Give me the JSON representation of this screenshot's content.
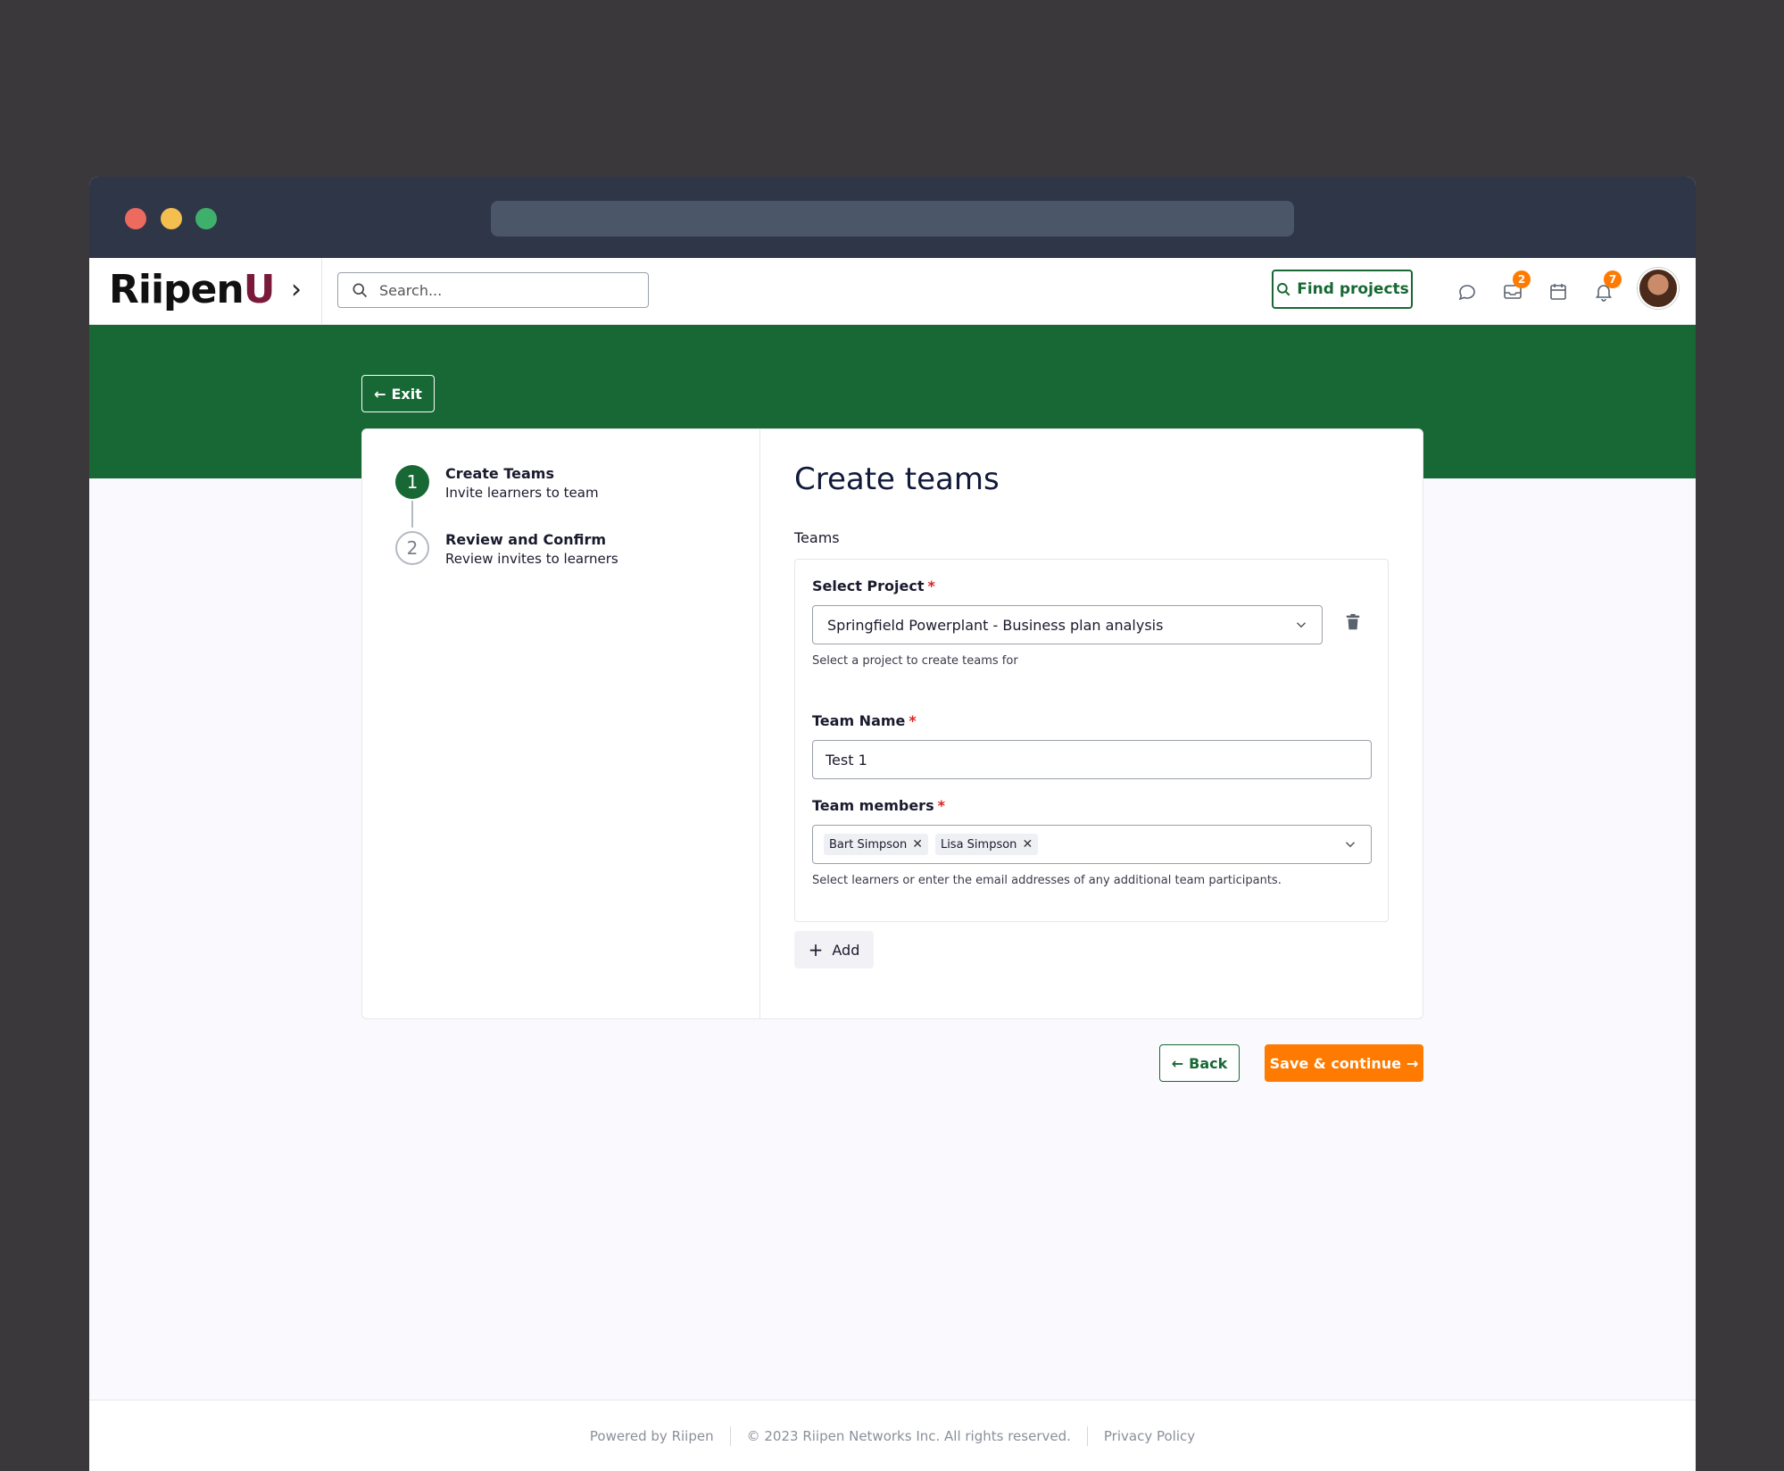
{
  "app": {
    "logo_main": "Riipen",
    "logo_accent": "U"
  },
  "search": {
    "placeholder": "Search..."
  },
  "topnav": {
    "find_projects_label": "Find projects",
    "icons": [
      {
        "name": "chat-icon",
        "badge": ""
      },
      {
        "name": "inbox-icon",
        "badge": "2"
      },
      {
        "name": "calendar-icon",
        "badge": ""
      },
      {
        "name": "bell-icon",
        "badge": "7"
      }
    ]
  },
  "exit_label": "Exit",
  "steps": [
    {
      "number": "1",
      "title": "Create Teams",
      "subtitle": "Invite learners to team",
      "active": true
    },
    {
      "number": "2",
      "title": "Review and Confirm",
      "subtitle": "Review invites to learners",
      "active": false
    }
  ],
  "form": {
    "title": "Create teams",
    "section_label": "Teams",
    "project": {
      "label": "Select Project",
      "required": "*",
      "value": "Springfield Powerplant - Business plan analysis",
      "help": "Select a project to create teams for"
    },
    "team_name": {
      "label": "Team Name",
      "required": "*",
      "value": "Test 1"
    },
    "team_members": {
      "label": "Team members",
      "required": "*",
      "chips": [
        "Bart Simpson",
        "Lisa Simpson"
      ],
      "help": "Select learners or enter the email addresses of any additional team participants."
    },
    "add_label": "Add"
  },
  "actions": {
    "back_label": "Back",
    "save_label": "Save & continue"
  },
  "footer": {
    "powered": "Powered by Riipen",
    "copyright": "© 2023 Riipen Networks Inc. All rights reserved.",
    "privacy": "Privacy Policy"
  },
  "colors": {
    "brand_green": "#176834",
    "accent_orange": "#ff7a00",
    "logo_accent": "#7a1a3a"
  }
}
